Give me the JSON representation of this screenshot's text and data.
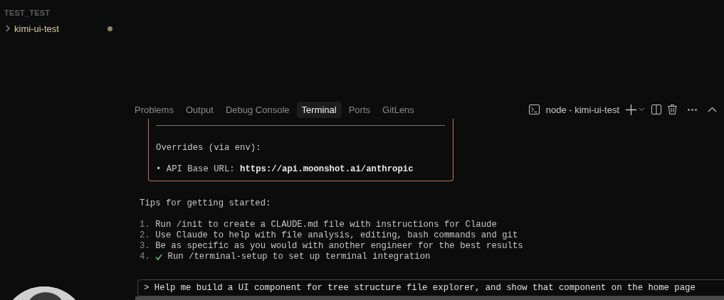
{
  "sidebar": {
    "section_title": "TEST_TEST",
    "items": [
      {
        "label": "kimi-ui-test",
        "expanded": false,
        "modified": true
      }
    ]
  },
  "panel": {
    "tabs": [
      {
        "label": "Problems",
        "selected": false
      },
      {
        "label": "Output",
        "selected": false
      },
      {
        "label": "Debug Console",
        "selected": false
      },
      {
        "label": "Terminal",
        "selected": true
      },
      {
        "label": "Ports",
        "selected": false
      },
      {
        "label": "GitLens",
        "selected": false
      }
    ],
    "terminal_name": "node - kimi-ui-test"
  },
  "terminal": {
    "box_lines": [
      {
        "text": "Overrides (via env):"
      },
      {
        "text": "• API Base URL: **https://api.moonshot.ai/anthropic**"
      }
    ],
    "tips_title": "Tips for getting started:",
    "tips": [
      {
        "number": "1.",
        "text": "Run /init to create a CLAUDE.md file with instructions for Claude",
        "done": false
      },
      {
        "number": "2.",
        "text": "Use Claude to help with file analysis, editing, bash commands and git",
        "done": false
      },
      {
        "number": "3.",
        "text": "Be as specific as you would with another engineer for the best results",
        "done": false
      },
      {
        "number": "4.",
        "text": "Run /terminal-setup to set up terminal integration",
        "done": true
      }
    ],
    "prompt": {
      "symbol": ">",
      "value": "Help me build a UI component for tree structure file explorer, and show that component on the home page"
    }
  }
}
